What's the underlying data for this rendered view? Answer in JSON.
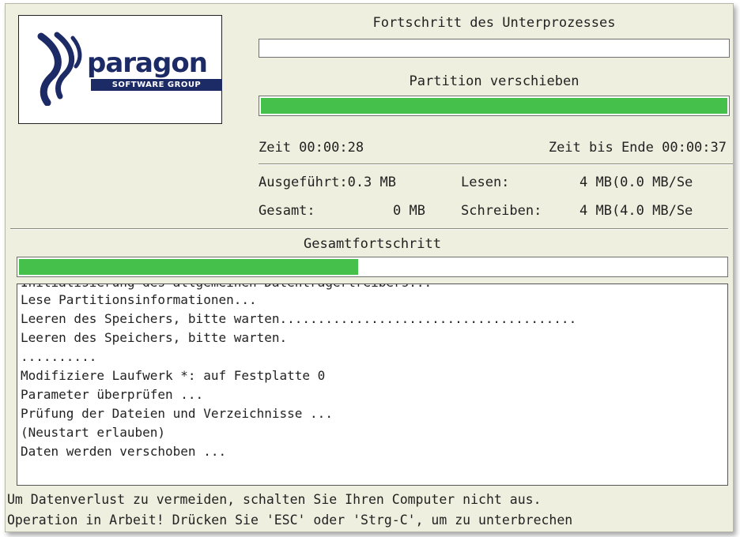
{
  "logo": {
    "wordmark": "paragon",
    "subtitle": "SOFTWARE GROUP"
  },
  "subprocess": {
    "title": "Fortschritt des Unterprozesses",
    "progress": 0.0
  },
  "operation": {
    "title": "Partition verschieben",
    "progress": 1.0
  },
  "timing": {
    "elapsed": "Zeit 00:00:28",
    "remaining": "Zeit bis Ende 00:00:37"
  },
  "stats": {
    "done_label": "Ausgeführt:0.3 MB",
    "read_label": "Lesen:",
    "read_value": "4 MB(0.0 MB/Se",
    "total_label": "Gesamt:",
    "total_value": "0 MB",
    "write_label": "Schreiben:",
    "write_value": "4 MB(4.0 MB/Se"
  },
  "overall": {
    "title": "Gesamtfortschritt",
    "progress": 0.48
  },
  "log": {
    "lines": [
      "Initialisierung des allgemeinen Datenträgertreibers...",
      "Lese Partitionsinformationen...",
      "Leeren des Speichers, bitte warten.......................................",
      "Leeren des Speichers, bitte warten.",
      "..........",
      "Modifiziere Laufwerk *: auf Festplatte 0",
      "Parameter überprüfen ...",
      "Prüfung der Dateien und Verzeichnisse ...",
      "(Neustart erlauben)",
      "Daten werden verschoben ..."
    ]
  },
  "footer": {
    "warning": "Um Datenverlust zu vermeiden, schalten Sie Ihren Computer nicht aus.",
    "hint": "Operation in Arbeit! Drücken Sie 'ESC' oder 'Strg-C', um zu unterbrechen"
  },
  "colors": {
    "background": "#efefdf",
    "progress_fill": "#45c04a",
    "logo_navy": "#1c2a66"
  }
}
